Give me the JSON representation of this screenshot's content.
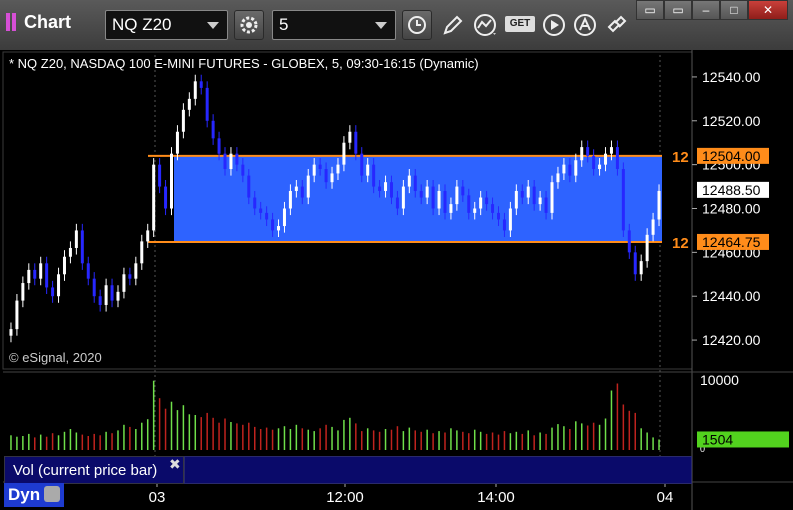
{
  "toolbar": {
    "app_title": "Chart",
    "symbol_value": "NQ Z20",
    "interval_value": "5",
    "get_label": "GET",
    "icons": [
      "settings-gear-icon",
      "clock-icon",
      "pencil-draw-icon",
      "study-icon",
      "get-data-icon",
      "play-icon",
      "alert-icon",
      "link-icon"
    ]
  },
  "window": {
    "restore_label": "▭",
    "minimize_label": "–",
    "maximize_label": "□",
    "close_label": "✕"
  },
  "chart": {
    "header": "* NQ Z20, NASDAQ 100 E-MINI FUTURES - GLOBEX, 5, 09:30-16:15 (Dynamic)",
    "copyright": "© eSignal, 2020",
    "price_ticks": [
      "12540.00",
      "12520.00",
      "12500.00",
      "12480.00",
      "12460.00",
      "12440.00",
      "12420.00"
    ],
    "range_top_label": "12504.00",
    "range_bottom_label": "12464.75",
    "range_top_prefix": "12",
    "range_bottom_prefix": "12",
    "last_price_label": "12488.50",
    "time_ticks": [
      "03",
      "12:00",
      "14:00",
      "04"
    ],
    "volume_ticks": [
      "10000",
      "0"
    ],
    "volume_last_label": "1504",
    "volume_study_label": "Vol (current price bar)",
    "bottom_tab_label": "Dyn",
    "colors": {
      "up": "#ffffff",
      "down": "#2727ff",
      "range_fill": "#2e63ff",
      "range_line": "#ff8c1a",
      "vol_up": "#6fe04a",
      "vol_down": "#c0231e",
      "last_price_box": "#ffffff",
      "vol_last_box": "#52d21e"
    }
  },
  "chart_data": {
    "type": "candlestick",
    "title": "* NQ Z20, NASDAQ 100 E-MINI FUTURES - GLOBEX, 5, 09:30-16:15 (Dynamic)",
    "ylim": [
      12410,
      12550
    ],
    "range_box": {
      "top": 12504.0,
      "bottom": 12464.75
    },
    "last_price": 12488.5,
    "volume_last": 1504,
    "volume_ylim": [
      0,
      10000
    ],
    "closes": [
      12425,
      12438,
      12446,
      12452,
      12448,
      12455,
      12444,
      12440,
      12450,
      12458,
      12462,
      12470,
      12455,
      12448,
      12440,
      12436,
      12445,
      12438,
      12442,
      12450,
      12448,
      12455,
      12465,
      12470,
      12500,
      12490,
      12480,
      12505,
      12515,
      12525,
      12530,
      12538,
      12535,
      12520,
      12512,
      12505,
      12498,
      12505,
      12500,
      12495,
      12485,
      12480,
      12478,
      12475,
      12470,
      12472,
      12480,
      12488,
      12490,
      12485,
      12495,
      12500,
      12498,
      12492,
      12496,
      12500,
      12510,
      12515,
      12505,
      12495,
      12500,
      12490,
      12488,
      12492,
      12485,
      12480,
      12490,
      12495,
      12488,
      12485,
      12490,
      12480,
      12488,
      12478,
      12482,
      12490,
      12486,
      12478,
      12480,
      12485,
      12482,
      12478,
      12475,
      12470,
      12480,
      12488,
      12485,
      12490,
      12482,
      12485,
      12478,
      12492,
      12496,
      12500,
      12495,
      12502,
      12508,
      12504,
      12498,
      12500,
      12505,
      12508,
      12498,
      12470,
      12460,
      12450,
      12456,
      12468,
      12475,
      12488
    ],
    "volumes": [
      2100,
      1900,
      2000,
      2300,
      1800,
      2200,
      1900,
      2400,
      2100,
      2600,
      3000,
      2500,
      2200,
      2000,
      2300,
      2100,
      2600,
      2400,
      2800,
      3600,
      3300,
      3000,
      3900,
      4400,
      9900,
      7400,
      5900,
      6900,
      5700,
      6400,
      5100,
      5000,
      4700,
      5300,
      4600,
      3900,
      4500,
      4000,
      3800,
      3600,
      3900,
      3300,
      3000,
      3200,
      2900,
      3100,
      3400,
      3000,
      3600,
      3100,
      2900,
      2700,
      3100,
      3600,
      3300,
      2800,
      4300,
      4600,
      3800,
      2700,
      3100,
      2800,
      2600,
      3000,
      2900,
      3400,
      2700,
      3200,
      2800,
      2600,
      2900,
      2400,
      2700,
      2500,
      3100,
      2800,
      2600,
      2400,
      2900,
      2600,
      2300,
      2500,
      2200,
      2700,
      2400,
      2600,
      2300,
      2800,
      2100,
      2500,
      2300,
      3200,
      3700,
      3400,
      3000,
      4100,
      3800,
      3500,
      3900,
      3600,
      4500,
      8500,
      9500,
      6500,
      5600,
      5300,
      3100,
      2500,
      1800,
      1504
    ]
  }
}
